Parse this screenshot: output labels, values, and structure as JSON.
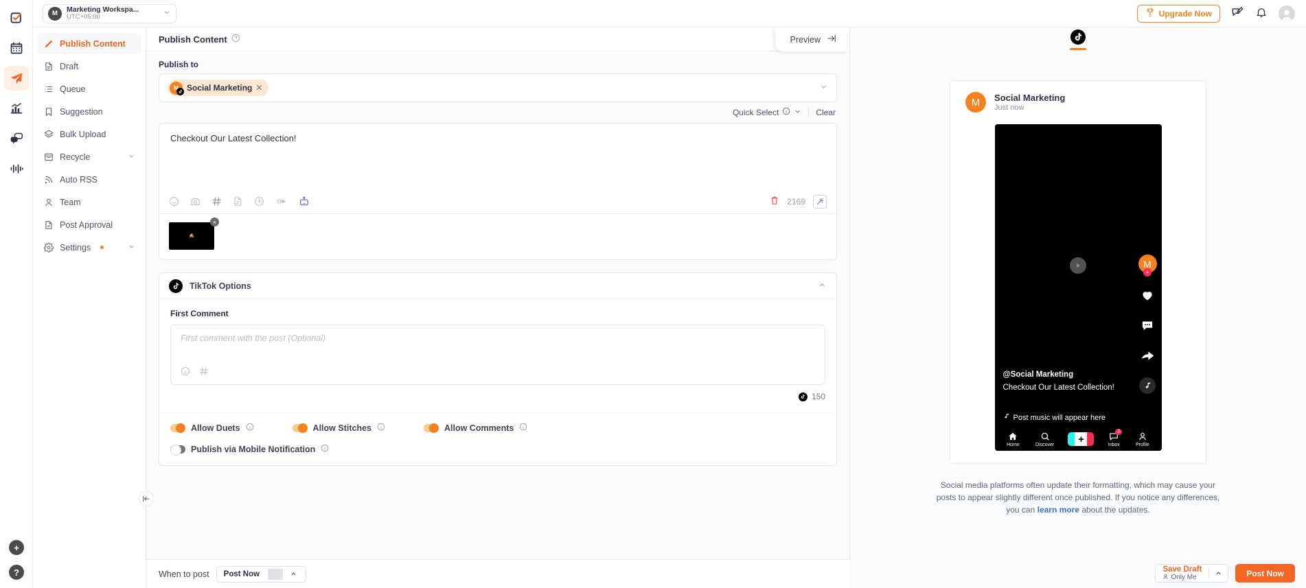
{
  "colors": {
    "accent": "#f26522",
    "accent_light": "#f58220",
    "link": "#3b6fd4",
    "tiktok_pink": "#fe2c55",
    "tiktok_cyan": "#25f4ee"
  },
  "topbar": {
    "workspace": {
      "avatar_letter": "M",
      "name": "Marketing Workspa...",
      "timezone": "UTC+05:00"
    },
    "upgrade_label": "Upgrade Now"
  },
  "rail": {
    "items": [
      {
        "name": "tasks-icon",
        "label": "Tasks"
      },
      {
        "name": "calendar-icon",
        "label": "Calendar"
      },
      {
        "name": "publish-icon",
        "label": "Publish"
      },
      {
        "name": "analytics-icon",
        "label": "Analytics"
      },
      {
        "name": "inbox-icon",
        "label": "Inbox"
      },
      {
        "name": "listening-icon",
        "label": "Listening"
      }
    ],
    "add_label": "+",
    "help_label": "?"
  },
  "sidebar": {
    "items": [
      {
        "label": "Publish Content",
        "icon": "pencil-icon",
        "active": true,
        "chevron": false,
        "dot": false
      },
      {
        "label": "Draft",
        "icon": "document-icon",
        "active": false,
        "chevron": false,
        "dot": false
      },
      {
        "label": "Queue",
        "icon": "list-icon",
        "active": false,
        "chevron": false,
        "dot": false
      },
      {
        "label": "Suggestion",
        "icon": "bookmark-icon",
        "active": false,
        "chevron": false,
        "dot": false
      },
      {
        "label": "Bulk Upload",
        "icon": "layers-icon",
        "active": false,
        "chevron": false,
        "dot": false
      },
      {
        "label": "Recycle",
        "icon": "archive-icon",
        "active": false,
        "chevron": true,
        "dot": false
      },
      {
        "label": "Auto RSS",
        "icon": "rss-icon",
        "active": false,
        "chevron": false,
        "dot": false
      },
      {
        "label": "Team",
        "icon": "user-icon",
        "active": false,
        "chevron": false,
        "dot": false
      },
      {
        "label": "Post Approval",
        "icon": "approval-icon",
        "active": false,
        "chevron": false,
        "dot": false
      },
      {
        "label": "Settings",
        "icon": "gear-icon",
        "active": false,
        "chevron": true,
        "dot": true
      }
    ]
  },
  "main": {
    "title": "Publish Content",
    "preview_tab_label": "Preview",
    "publish_to_label": "Publish to",
    "account_chip": {
      "name": "Social Marketing",
      "avatar_letter": "M",
      "platform": "tiktok"
    },
    "quick_select_label": "Quick Select",
    "clear_label": "Clear",
    "editor": {
      "content": "Checkout Our Latest Collection!",
      "char_count": "2169",
      "tools": [
        "emoji-icon",
        "camera-icon",
        "hashtag-icon",
        "template-icon",
        "history-icon",
        "link-icon",
        "ai-bot-icon"
      ],
      "trash_icon": "trash-icon",
      "wand_icon": "magic-wand-icon"
    },
    "media": {
      "remove_label": "×"
    },
    "options": {
      "title": "TikTok Options",
      "first_comment_label": "First Comment",
      "first_comment_placeholder": "First comment with the post (Optional)",
      "first_comment_value": "",
      "first_comment_count": "150",
      "toggles": [
        {
          "label": "Allow Duets",
          "on": true
        },
        {
          "label": "Allow Stitches",
          "on": true
        },
        {
          "label": "Allow Comments",
          "on": true
        },
        {
          "label": "Publish via Mobile Notification",
          "on": false
        }
      ]
    }
  },
  "bottombar": {
    "when_to_post_label": "When to post",
    "schedule_value": "Post Now",
    "save_draft_label": "Save Draft",
    "save_draft_sub": "Only Me",
    "post_now_label": "Post Now"
  },
  "preview": {
    "active_tab": "tiktok",
    "card": {
      "account_name": "Social Marketing",
      "timestamp": "Just now",
      "avatar_letter": "M"
    },
    "phone": {
      "handle": "@Social Marketing",
      "caption": "Checkout Our Latest Collection!",
      "music_text": "Post music will appear here",
      "avatar_letter": "M",
      "follow_plus": "+",
      "nav": [
        {
          "label": "Home",
          "icon": "home-icon",
          "badge": ""
        },
        {
          "label": "Discover",
          "icon": "search-icon",
          "badge": ""
        },
        {
          "label": "",
          "icon": "create-icon",
          "badge": ""
        },
        {
          "label": "Inbox",
          "icon": "inbox-icon",
          "badge": "2"
        },
        {
          "label": "Profile",
          "icon": "profile-icon",
          "badge": ""
        }
      ]
    },
    "note_line1": "Social media platforms often update their formatting, which may cause your",
    "note_line2": "posts to appear slightly different once published.",
    "note_line3_pre": "If you notice any differences, you can ",
    "note_link": "learn more",
    "note_line3_post": " about the updates."
  }
}
